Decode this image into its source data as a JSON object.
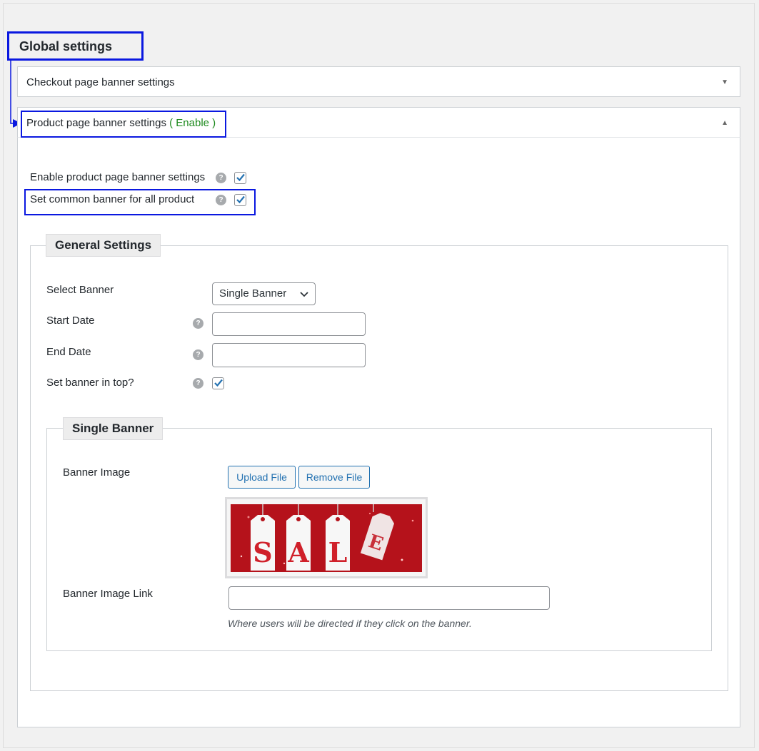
{
  "global_title": "Global settings",
  "accordions": {
    "checkout": {
      "label": "Checkout page banner settings"
    },
    "product": {
      "label": "Product page banner settings",
      "status": "( Enable )"
    }
  },
  "product_settings": {
    "enable_label": "Enable product page banner settings",
    "enable_checked": true,
    "common_label": "Set common banner for all product",
    "common_checked": true
  },
  "general_settings": {
    "legend": "General Settings",
    "select_banner_label": "Select Banner",
    "select_banner_value": "Single Banner",
    "start_date_label": "Start Date",
    "start_date_value": "",
    "end_date_label": "End Date",
    "end_date_value": "",
    "banner_top_label": "Set banner in top?",
    "banner_top_checked": true
  },
  "single_banner": {
    "legend": "Single Banner",
    "image_label": "Banner Image",
    "upload_label": "Upload File",
    "remove_label": "Remove File",
    "image_text": "SALE",
    "link_label": "Banner Image Link",
    "link_value": "",
    "link_help": "Where users will be directed if they click on the banner."
  },
  "help_icon_glyph": "?",
  "colors": {
    "annotation_blue": "#0a18e0",
    "enable_green": "#1e8a1e",
    "sale_red": "#b5121b"
  }
}
